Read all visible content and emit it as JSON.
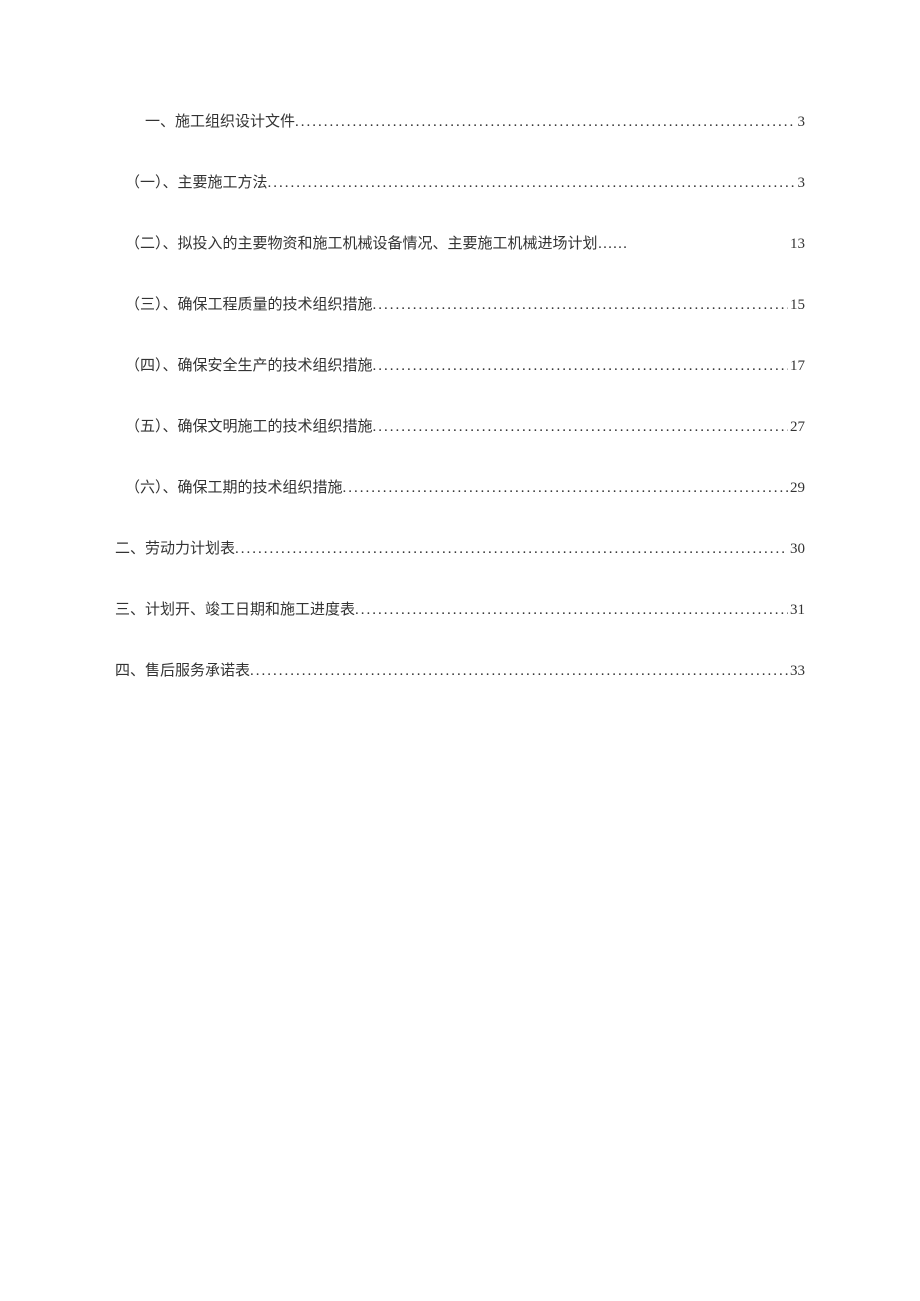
{
  "toc": [
    {
      "title": "一、施工组织设计文件",
      "page": "3",
      "indent": "indent-1",
      "leaderType": "dots"
    },
    {
      "title": "（一）、主要施工方法",
      "page": "3",
      "indent": "indent-0-5",
      "leaderType": "dots"
    },
    {
      "title": "（二）、拟投入的主要物资和施工机械设备情况、主要施工机械进场计划",
      "page": "13",
      "indent": "indent-0-5",
      "leaderType": "cn"
    },
    {
      "title": "（三）、确保工程质量的技术组织措施",
      "page": "15",
      "indent": "indent-0-5",
      "leaderType": "dots"
    },
    {
      "title": "（四）、确保安全生产的技术组织措施",
      "page": "17",
      "indent": "indent-0-5",
      "leaderType": "dots"
    },
    {
      "title": "（五）、确保文明施工的技术组织措施",
      "page": "27",
      "indent": "indent-0-5",
      "leaderType": "dots"
    },
    {
      "title": "（六）、确保工期的技术组织措施",
      "page": "29",
      "indent": "indent-0-5",
      "leaderType": "dots"
    },
    {
      "title": "二、劳动力计划表",
      "page": "30",
      "indent": "",
      "leaderType": "dots"
    },
    {
      "title": "三、计划开、竣工日期和施工进度表",
      "page": "31",
      "indent": "",
      "leaderType": "dots"
    },
    {
      "title": "四、售后服务承诺表",
      "page": "33",
      "indent": "",
      "leaderType": "dots"
    }
  ]
}
